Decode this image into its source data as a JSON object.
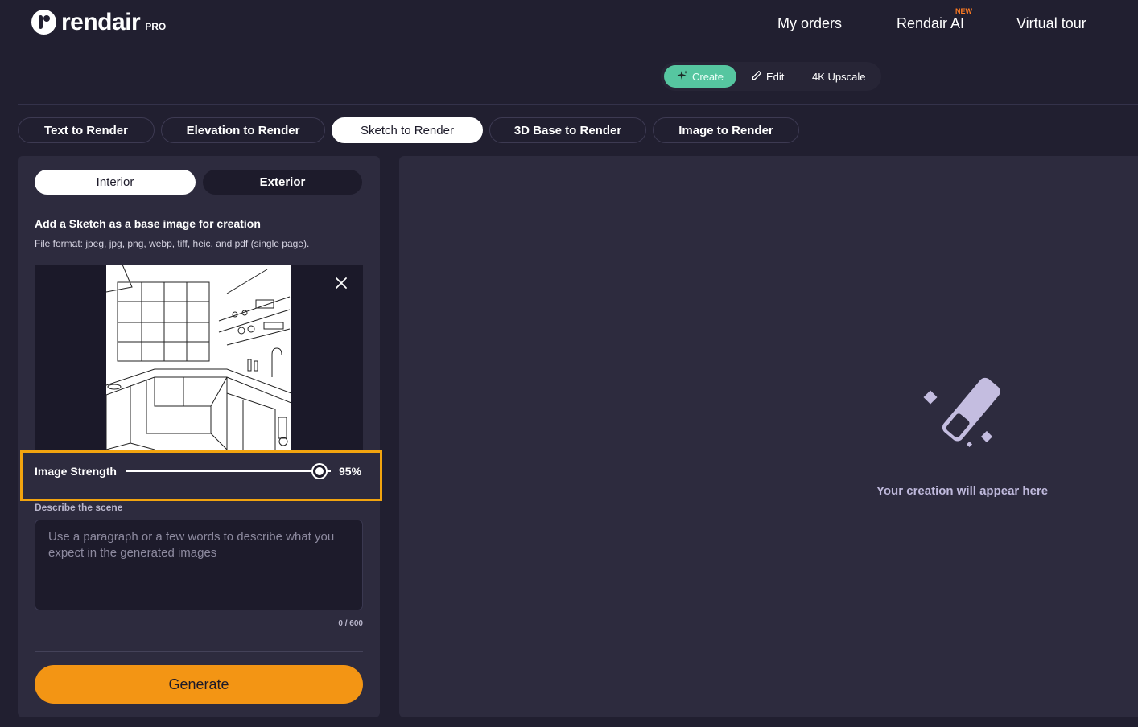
{
  "header": {
    "brand": "rendair",
    "brand_suffix": "PRO",
    "nav": {
      "orders": "My orders",
      "ai": "Rendair AI",
      "ai_badge": "NEW",
      "tour": "Virtual tour"
    },
    "modes": {
      "create": "Create",
      "edit": "Edit",
      "upscale": "4K Upscale",
      "active": "Create"
    }
  },
  "tabs": [
    {
      "label": "Text to Render"
    },
    {
      "label": "Elevation to Render"
    },
    {
      "label": "Sketch to Render"
    },
    {
      "label": "3D Base to Render"
    },
    {
      "label": "Image to Render"
    }
  ],
  "active_tab": "Sketch to Render",
  "panel": {
    "space": {
      "interior": "Interior",
      "exterior": "Exterior",
      "selected": "Interior"
    },
    "upload": {
      "title": "Add a Sketch as a base image for creation",
      "formats": "File format: jpeg, jpg, png, webp, tiff, heic, and pdf (single page)."
    },
    "strength": {
      "label": "Image Strength",
      "value": 95,
      "display": "95%"
    },
    "describe": {
      "label": "Describe the scene",
      "placeholder": "Use a paragraph or a few words to describe what you expect in the generated images",
      "value": "",
      "count": "0 / 600"
    },
    "generate_label": "Generate"
  },
  "output": {
    "empty_text": "Your creation will appear here"
  },
  "colors": {
    "accent_green": "#56c6a0",
    "accent_orange": "#f39514",
    "highlight_box": "#f2a40f",
    "new_badge": "#ff7b22",
    "background": "#211f30",
    "panel": "#2d2b3e"
  },
  "icons": {
    "create": "sparkle-icon",
    "edit": "pencil-icon",
    "close": "close-icon",
    "placeholder": "magic-wand-icon"
  }
}
